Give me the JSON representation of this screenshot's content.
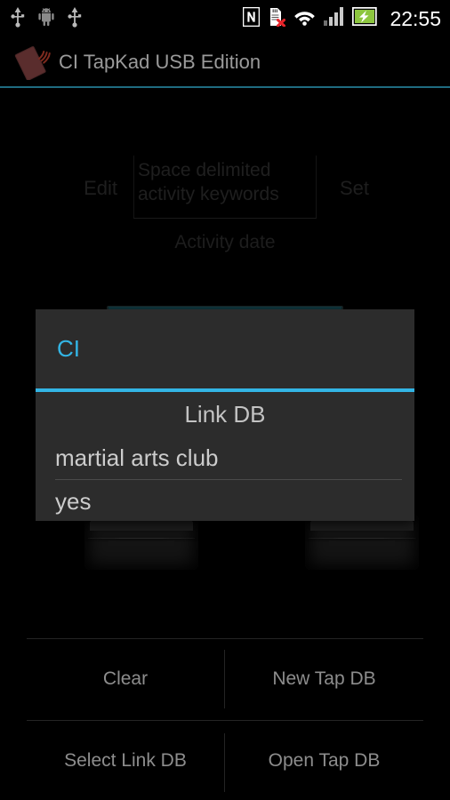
{
  "status_bar": {
    "left_icons": [
      "usb-icon",
      "android-robot-icon",
      "usb-icon"
    ],
    "right_icons": [
      "nfc-icon",
      "sd-card-error-icon",
      "wifi-icon",
      "signal-bars-icon",
      "battery-charging-icon"
    ],
    "clock": "22:55"
  },
  "title_bar": {
    "icon": "nfc-card-icon",
    "title": "CI TapKad USB Edition",
    "accent_color": "#1f6b80"
  },
  "main": {
    "edit_label": "Edit",
    "keyword_placeholder": "Space delimited activity keywords",
    "set_label": "Set",
    "activity_date_label": "Activity date"
  },
  "dialog": {
    "title": "CI",
    "title_color": "#33b5e5",
    "heading": "Link DB",
    "items": [
      {
        "label": "martial arts club"
      },
      {
        "label": "yes"
      }
    ]
  },
  "bottom_buttons": {
    "row1": [
      {
        "label": "Clear",
        "name": "clear-button"
      },
      {
        "label": "New Tap DB",
        "name": "new-tap-db-button"
      }
    ],
    "row2": [
      {
        "label": "Select Link DB",
        "name": "select-link-db-button"
      },
      {
        "label": "Open Tap DB",
        "name": "open-tap-db-button"
      }
    ]
  }
}
